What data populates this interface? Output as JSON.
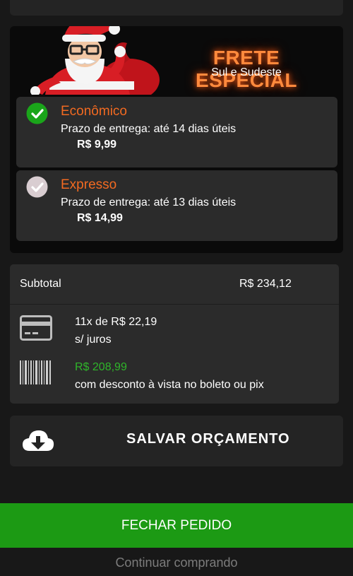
{
  "promo": {
    "title": "FRETE ESPECIAL",
    "subtitle": "Sul e Sudeste"
  },
  "shipping_options": [
    {
      "name": "Econômico",
      "delivery": "Prazo de entrega: até 14 dias úteis",
      "price": "R$ 9,99",
      "selected": true
    },
    {
      "name": "Expresso",
      "delivery": "Prazo de entrega: até 13 dias úteis",
      "price": "R$ 14,99",
      "selected": false
    }
  ],
  "summary": {
    "subtotal_label": "Subtotal",
    "subtotal_value": "R$ 234,12",
    "installments_line": "11x de R$ 22,19",
    "installments_note": "s/ juros",
    "cash_price": "R$ 208,99",
    "cash_note": "com desconto à vista no boleto ou pix"
  },
  "actions": {
    "save_quote": "SALVAR ORÇAMENTO",
    "checkout": "FECHAR PEDIDO",
    "continue_shopping": "Continuar comprando"
  },
  "colors": {
    "accent_orange": "#f26a21",
    "success_green": "#1c9a14",
    "cash_green": "#2fb52a"
  },
  "icons": [
    "santa-mascot",
    "check-icon",
    "credit-card-icon",
    "barcode-icon",
    "cloud-download-icon"
  ]
}
